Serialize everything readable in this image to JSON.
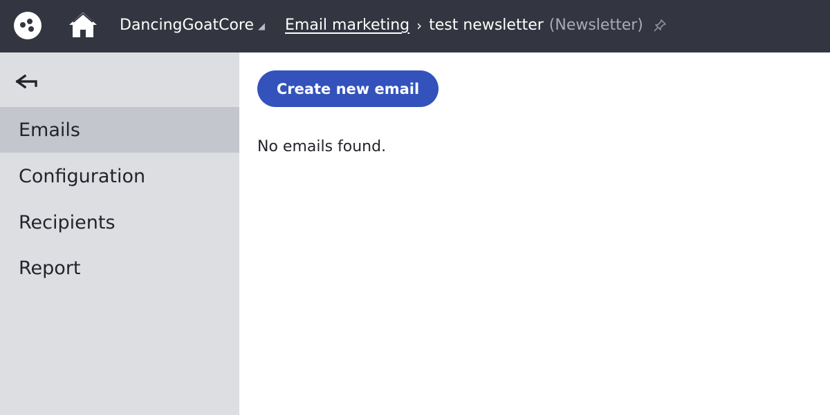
{
  "header": {
    "site_name": "DancingGoatCore",
    "site_dropdown_glyph": "◢",
    "breadcrumb": {
      "parent": "Email marketing",
      "separator": "›",
      "current": "test newsletter",
      "current_type": "(Newsletter)"
    },
    "icons": [
      "app-logo-icon",
      "home-icon",
      "pin-icon"
    ]
  },
  "sidebar": {
    "back_icon": "back-arrow-icon",
    "items": [
      {
        "label": "Emails",
        "active": true
      },
      {
        "label": "Configuration",
        "active": false
      },
      {
        "label": "Recipients",
        "active": false
      },
      {
        "label": "Report",
        "active": false
      }
    ]
  },
  "main": {
    "create_button_label": "Create new email",
    "empty_message": "No emails found."
  },
  "colors": {
    "topbar": "#333640",
    "sidebar": "#dcdee2",
    "sidebar_active": "#c3c6cd",
    "primary_button": "#3352bc"
  }
}
